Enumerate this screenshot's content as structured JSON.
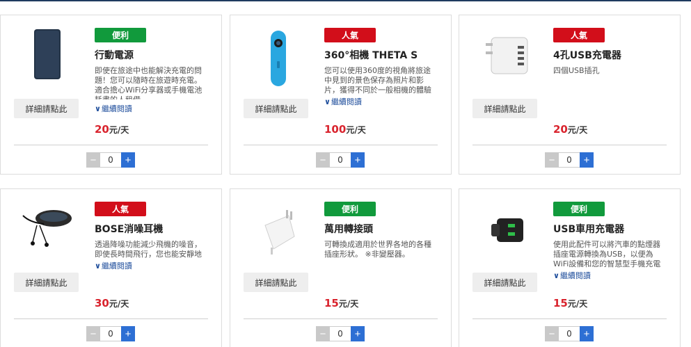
{
  "colors": {
    "badge_green": "#119a3c",
    "badge_red": "#d20e1a",
    "price_red": "#d9232d",
    "link_blue": "#1f4e9c",
    "plus_blue": "#2d6fd4"
  },
  "common": {
    "detail_label": "詳細請點此",
    "more_label": "繼續閱讀",
    "quantity": "0",
    "minus": "−",
    "plus": "+"
  },
  "products": [
    {
      "badge": "便利",
      "badge_color": "green",
      "name": "行動電源",
      "description": "即使在旅途中也能解決充電的問題！您可以隨時在旅遊時充電。適合擔心WiFi分享器或手機電池耗盡的人租借",
      "price": "20",
      "unit": "元/天",
      "image_icon": "power-bank-icon"
    },
    {
      "badge": "人氣",
      "badge_color": "red",
      "name": "360°相機 THETA S",
      "description": "您可以使用360度的視角將旅途中見到的景色保存為照片和影片，獲得不同於一般相機的體驗",
      "price": "100",
      "unit": "元/天",
      "image_icon": "camera-360-icon"
    },
    {
      "badge": "人氣",
      "badge_color": "red",
      "name": "4孔USB充電器",
      "description": "四個USB插孔",
      "price": "20",
      "unit": "元/天",
      "image_icon": "usb-charger-icon"
    },
    {
      "badge": "人氣",
      "badge_color": "red",
      "name": "BOSE消噪耳機",
      "description": "透過降噪功能減少飛機的噪音，即使長時間飛行，您也能安靜地享受旅程",
      "price": "30",
      "unit": "元/天",
      "image_icon": "headphones-icon"
    },
    {
      "badge": "便利",
      "badge_color": "green",
      "name": "萬用轉接頭",
      "description": "可轉換成適用於世界各地的各種插座形狀。 ※非變壓器。",
      "price": "15",
      "unit": "元/天",
      "image_icon": "plug-adapter-icon"
    },
    {
      "badge": "便利",
      "badge_color": "green",
      "name": "USB車用充電器",
      "description": "使用此配件可以將汽車的點煙器插座電源轉換為USB，以便為WiFi設備和您的智慧型手機充電",
      "price": "15",
      "unit": "元/天",
      "image_icon": "car-charger-icon"
    }
  ]
}
